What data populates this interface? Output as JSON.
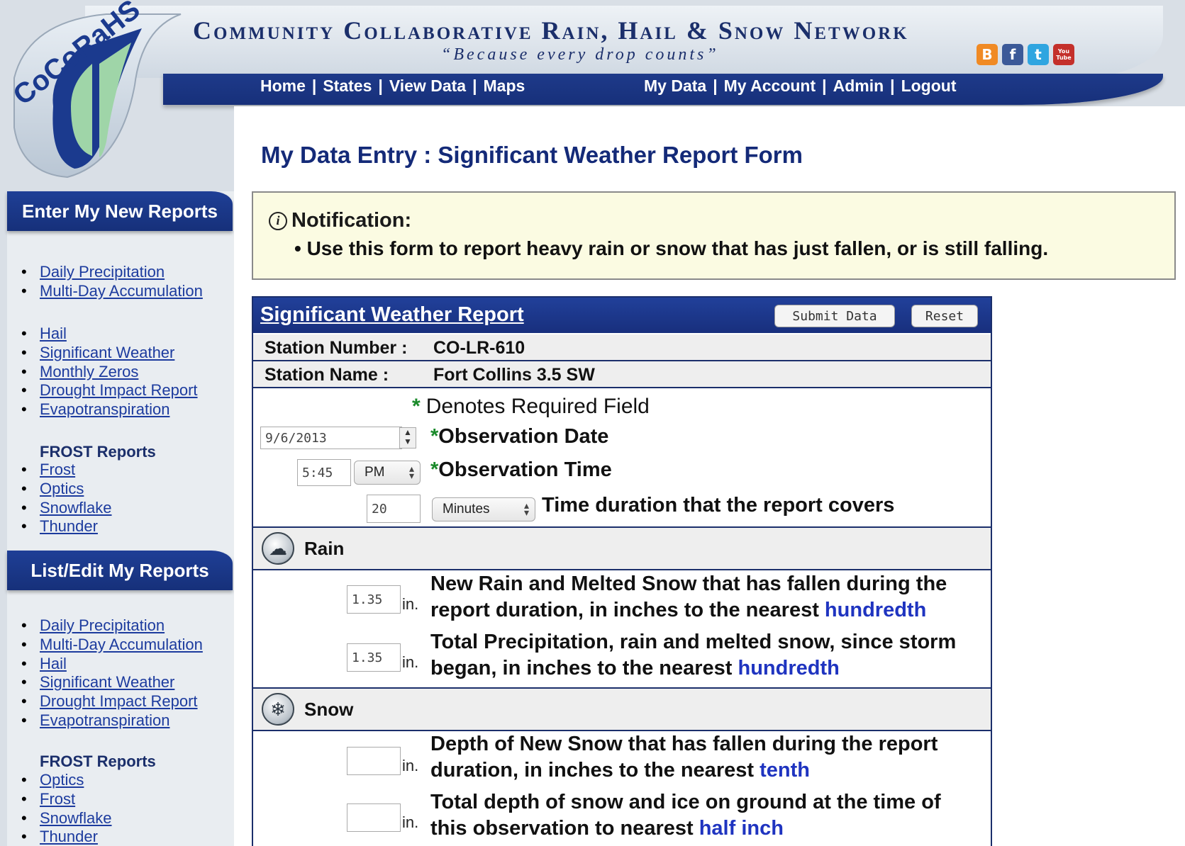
{
  "header": {
    "title": "Community Collaborative Rain, Hail & Snow Network",
    "tagline": "“Because every drop counts”",
    "logo_text": "CoCoRaHS",
    "social": [
      {
        "icon": "blogger-icon",
        "glyph": "B",
        "color": "#f08a24"
      },
      {
        "icon": "facebook-icon",
        "glyph": "f",
        "color": "#3b5998"
      },
      {
        "icon": "twitter-icon",
        "glyph": "t",
        "color": "#2fa5e0"
      },
      {
        "icon": "youtube-icon",
        "glyph": "You Tube",
        "color": "#c4302b"
      }
    ],
    "nav_left": [
      "Home",
      "States",
      "View Data",
      "Maps"
    ],
    "nav_right": [
      "My Data",
      "My Account",
      "Admin",
      "Logout"
    ],
    "separator": "|"
  },
  "sidebar": {
    "enter_heading": "Enter My New Reports",
    "enter_group1": [
      "Daily Precipitation",
      "Multi-Day Accumulation"
    ],
    "enter_group2": [
      "Hail",
      "Significant Weather",
      "Monthly Zeros",
      "Drought Impact Report",
      "Evapotranspiration"
    ],
    "frost_heading": "FROST Reports",
    "enter_frost": [
      "Frost",
      "Optics",
      "Snowflake",
      "Thunder"
    ],
    "list_heading": "List/Edit My Reports",
    "list_group": [
      "Daily Precipitation",
      "Multi-Day Accumulation",
      "Hail",
      "Significant Weather",
      "Drought Impact Report",
      "Evapotranspiration"
    ],
    "list_frost_heading": "FROST Reports",
    "list_frost": [
      "Optics",
      "Frost",
      "Snowflake",
      "Thunder"
    ]
  },
  "page": {
    "title": "My Data Entry : Significant Weather Report Form"
  },
  "notification": {
    "icon_glyph": "i",
    "title": "Notification:",
    "item": "• Use this form to report heavy rain or snow that has just fallen, or is still falling."
  },
  "form": {
    "title": "Significant Weather Report",
    "submit_label": "Submit Data",
    "reset_label": "Reset",
    "station_number_label": "Station Number :",
    "station_number": "CO-LR-610",
    "station_name_label": "Station Name :",
    "station_name": "Fort Collins 3.5 SW",
    "required_star": "*",
    "required_note": "Denotes Required Field",
    "obs_date_value": "9/6/2013",
    "obs_date_label": "Observation Date",
    "obs_time_value": "5:45",
    "obs_time_ampm": "PM",
    "obs_time_label": "Observation Time",
    "duration_value": "20",
    "duration_unit": "Minutes",
    "duration_label": "Time duration that the report covers",
    "rain_section": "Rain",
    "new_rain_value": "1.35",
    "unit_in": "in.",
    "new_rain_text": "New Rain and Melted Snow that has fallen during the report duration, in inches to the nearest ",
    "new_rain_link": "hundredth",
    "total_precip_value": "1.35",
    "total_precip_text": "Total Precipitation, rain and melted snow, since storm began, in inches to the nearest ",
    "total_precip_link": "hundredth",
    "snow_section": "Snow",
    "new_snow_value": "",
    "new_snow_text": "Depth of New Snow that has fallen during the report duration, in inches to the nearest ",
    "new_snow_link": "tenth",
    "total_snow_value": "",
    "total_snow_text": "Total depth of snow and ice on ground at the time of this observation to nearest ",
    "total_snow_link": "half inch"
  }
}
